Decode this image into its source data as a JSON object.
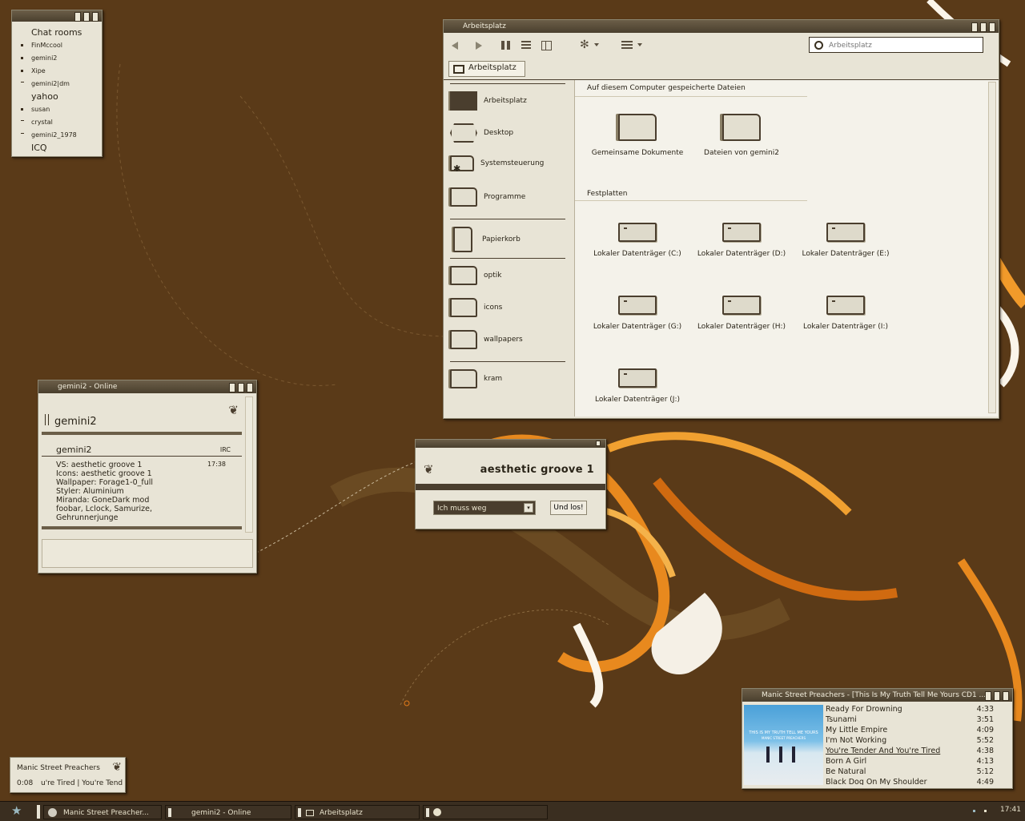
{
  "chat": {
    "title": "Chat rooms",
    "items": [
      {
        "label": "FinMccool",
        "mark": "dot"
      },
      {
        "label": "gemini2",
        "mark": "dot"
      },
      {
        "label": "Xipe",
        "mark": "dot"
      },
      {
        "label": "gemini2|dm",
        "mark": "dash"
      },
      {
        "label": "yahoo",
        "mark": "none"
      },
      {
        "label": "susan",
        "mark": "dot"
      },
      {
        "label": "crystal",
        "mark": "dash"
      },
      {
        "label": "gemini2_1978",
        "mark": "dash"
      },
      {
        "label": "ICQ",
        "mark": "none"
      }
    ]
  },
  "explorer": {
    "title": "Arbeitsplatz",
    "search_placeholder": "Arbeitsplatz",
    "location_tab": "Arbeitsplatz",
    "sidebar": [
      {
        "label": "Arbeitsplatz",
        "icon": "computer-icon"
      },
      {
        "label": "Desktop",
        "icon": "desktop-icon"
      },
      {
        "label": "Systemsteuerung",
        "icon": "control-panel-icon"
      },
      {
        "label": "Programme",
        "icon": "folder-icon"
      },
      {
        "label": "Papierkorb",
        "icon": "trash-icon"
      },
      {
        "label": "optik",
        "icon": "folder-icon"
      },
      {
        "label": "icons",
        "icon": "folder-icon"
      },
      {
        "label": "wallpapers",
        "icon": "folder-icon"
      },
      {
        "label": "kram",
        "icon": "folder-icon"
      }
    ],
    "section_files": "Auf diesem Computer gespeicherte Dateien",
    "files": [
      "Gemeinsame Dokumente",
      "Dateien von gemini2"
    ],
    "section_drives": "Festplatten",
    "drives": [
      "Lokaler Datenträger (C:)",
      "Lokaler Datenträger (D:)",
      "Lokaler Datenträger (E:)",
      "Lokaler Datenträger (G:)",
      "Lokaler Datenträger (H:)",
      "Lokaler Datenträger (I:)",
      "Lokaler Datenträger (J:)"
    ]
  },
  "msg": {
    "title": "gemini2 - Online",
    "contact_name": "gemini2",
    "sender": "gemini2",
    "protocol": "IRC",
    "time": "17:38",
    "lines": [
      "VS: aesthetic groove 1",
      "Icons: aesthetic groove 1",
      "Wallpaper: Forage1-0_full",
      "Styler: Aluminium",
      "Miranda: GoneDark mod",
      "foobar, Lclock, Samurize,",
      "Gehrunnerjunge"
    ]
  },
  "status_dialog": {
    "title": "aesthetic groove 1",
    "input_value": "Ich muss weg",
    "button": "Und los!"
  },
  "player": {
    "title": "Manic Street Preachers - [This Is My Truth Tell Me Yours CD1 ...",
    "album_cover_text": "THIS IS MY TRUTH TELL ME YOURS",
    "album_cover_band": "MANIC STREET PREACHERS",
    "tracks": [
      {
        "title": "Ready For Drowning",
        "duration": "4:33"
      },
      {
        "title": "Tsunami",
        "duration": "3:51"
      },
      {
        "title": "My Little Empire",
        "duration": "4:09"
      },
      {
        "title": "I'm Not Working",
        "duration": "5:52"
      },
      {
        "title": "You're Tender And You're Tired",
        "duration": "4:38",
        "current": true
      },
      {
        "title": "Born A Girl",
        "duration": "4:13"
      },
      {
        "title": "Be Natural",
        "duration": "5:12"
      },
      {
        "title": "Black Dog On My Shoulder",
        "duration": "4:49"
      }
    ]
  },
  "now_playing": {
    "artist": "Manic Street Preachers",
    "elapsed": "0:08",
    "track_scroll": "u're Tired | You're Tend"
  },
  "taskbar": {
    "items": [
      {
        "label": "Manic Street Preacher..."
      },
      {
        "label": "gemini2 - Online"
      },
      {
        "label": "Arbeitsplatz"
      }
    ],
    "clock": "17:41"
  },
  "colors": {
    "desktop": "#5a3a18",
    "window_bg": "#e8e4d6",
    "accent": "#4a3e2e",
    "orange": "#e07a1a"
  }
}
